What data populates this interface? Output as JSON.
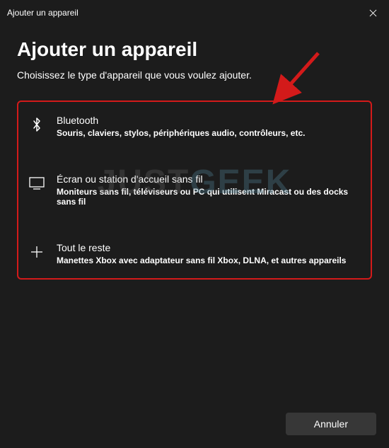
{
  "titlebar": {
    "title": "Ajouter un appareil"
  },
  "header": {
    "heading": "Ajouter un appareil",
    "subheading": "Choisissez le type d'appareil que vous voulez ajouter."
  },
  "options": [
    {
      "icon": "bluetooth-icon",
      "title": "Bluetooth",
      "description": "Souris, claviers, stylos, périphériques audio, contrôleurs, etc."
    },
    {
      "icon": "display-icon",
      "title": "Écran ou station d'accueil sans fil",
      "description": "Moniteurs sans fil, téléviseurs ou PC qui utilisent Miracast ou des docks sans fil"
    },
    {
      "icon": "plus-icon",
      "title": "Tout le reste",
      "description": "Manettes Xbox avec adaptateur sans fil Xbox, DLNA, et autres appareils"
    }
  ],
  "footer": {
    "cancel_label": "Annuler"
  },
  "watermark": {
    "part1": "JUST",
    "part2": "GEEK"
  },
  "annotation": {
    "highlight_color": "#d31a1a",
    "arrow_color": "#d31a1a"
  }
}
